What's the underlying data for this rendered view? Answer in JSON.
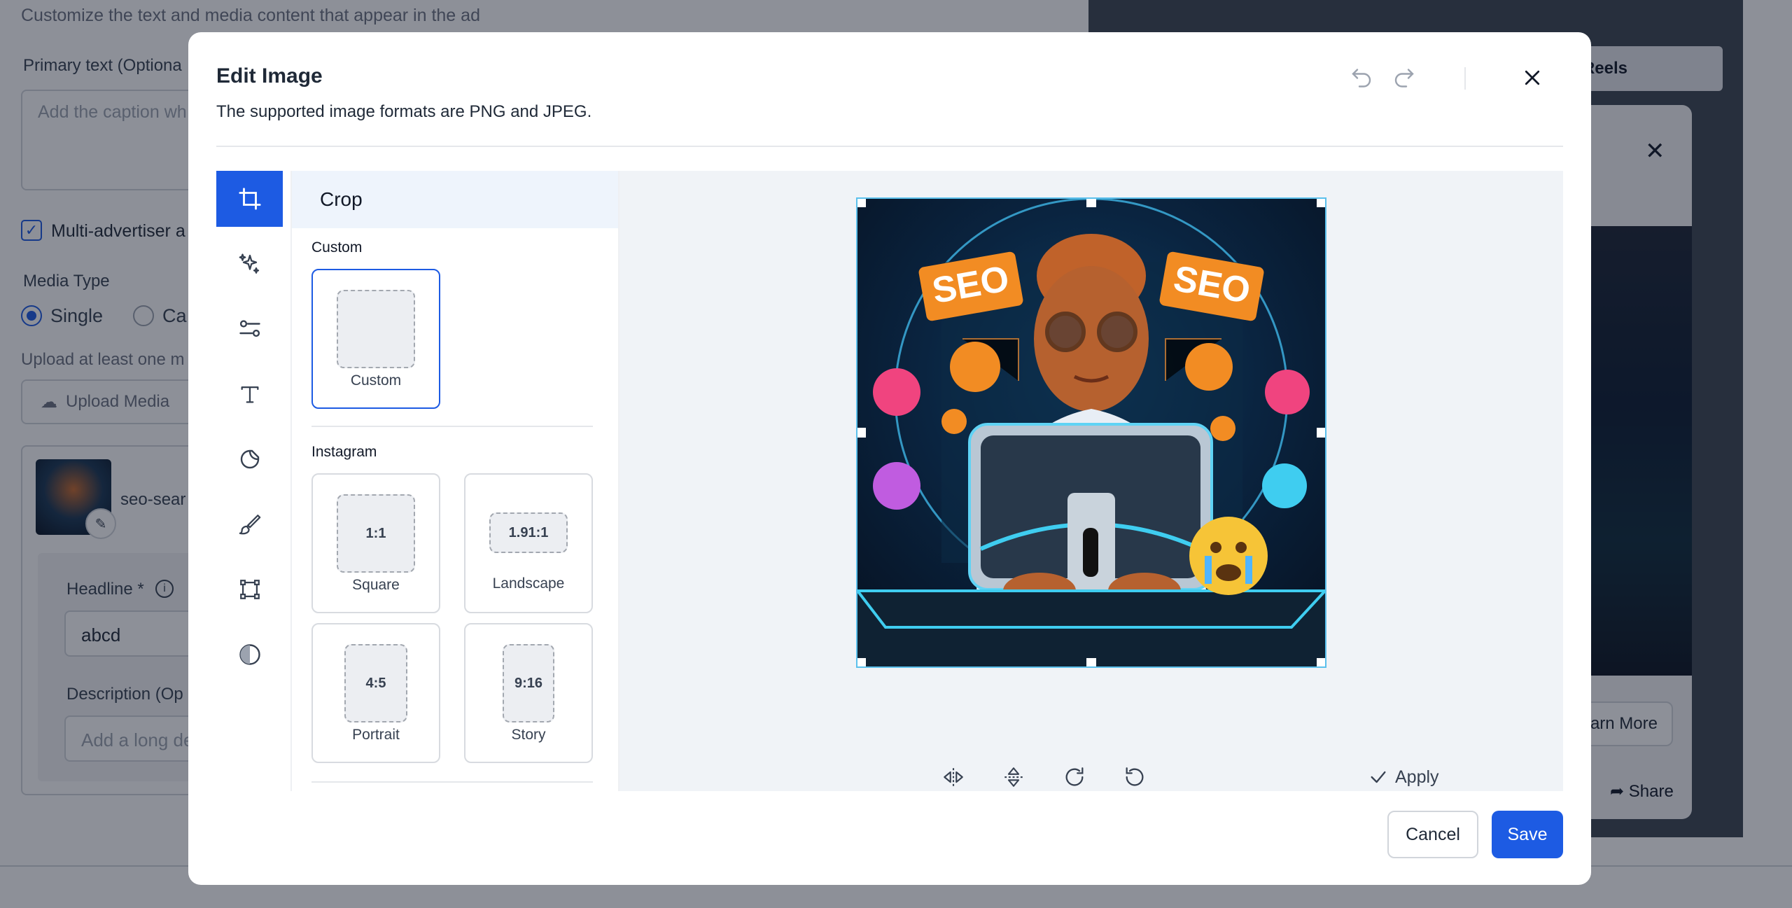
{
  "background": {
    "customize_text": "Customize the text and media content that appear in the ad",
    "primary_text_label": "Primary text (Optiona",
    "caption_placeholder": "Add the caption wh",
    "multi_advertiser": "Multi-advertiser a",
    "media_type_label": "Media Type",
    "media_single": "Single",
    "media_carousel": "Ca",
    "upload_hint": "Upload at least one m",
    "upload_button": "Upload Media",
    "file_name": "seo-sear",
    "headline_label": "Headline *",
    "headline_value": "abcd",
    "description_label": "Description (Op",
    "description_placeholder": "Add a long de",
    "preview_tab_reels": "Reels",
    "preview_learn_more": "arn More",
    "preview_share": "Share"
  },
  "modal": {
    "title": "Edit Image",
    "subtitle": "The supported image formats are PNG and JPEG.",
    "undo_icon": "undo-icon",
    "redo_icon": "redo-icon",
    "close_icon": "close-icon"
  },
  "tools": [
    {
      "name": "crop-tool",
      "icon": "crop-icon",
      "active": true
    },
    {
      "name": "enhance-tool",
      "icon": "sparkles-icon"
    },
    {
      "name": "adjust-tool",
      "icon": "sliders-icon"
    },
    {
      "name": "text-tool",
      "icon": "text-icon"
    },
    {
      "name": "sticker-tool",
      "icon": "sticker-icon"
    },
    {
      "name": "draw-tool",
      "icon": "brush-icon"
    },
    {
      "name": "shape-tool",
      "icon": "shape-icon"
    },
    {
      "name": "filter-tool",
      "icon": "contrast-icon"
    }
  ],
  "crop_panel": {
    "heading": "Crop",
    "custom_section": "Custom",
    "custom_tile_label": "Custom",
    "instagram_section": "Instagram",
    "presets": [
      {
        "ratio": "1:1",
        "label": "Square"
      },
      {
        "ratio": "1.91:1",
        "label": "Landscape"
      },
      {
        "ratio": "4:5",
        "label": "Portrait"
      },
      {
        "ratio": "9:16",
        "label": "Story"
      }
    ]
  },
  "image": {
    "sign_left": "SEO",
    "sign_right": "SEO"
  },
  "canvas_controls": {
    "flip_horizontal": "flip-horizontal-icon",
    "flip_vertical": "flip-vertical-icon",
    "rotate_right": "rotate-right-icon",
    "rotate_left": "rotate-left-icon",
    "apply_label": "Apply"
  },
  "footer": {
    "cancel_label": "Cancel",
    "save_label": "Save"
  },
  "colors": {
    "accent": "#1d5be3",
    "overlay": "#111827"
  }
}
